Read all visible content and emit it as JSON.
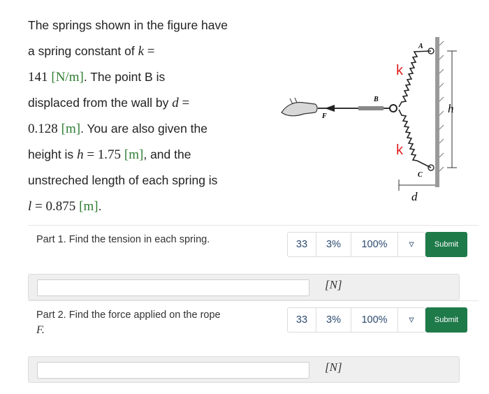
{
  "problem": {
    "t1": "The springs shown in the figure have",
    "t2": "a spring constant of",
    "k_sym": "k",
    "eq": "=",
    "k_val": "141",
    "k_unit": "[N/m]",
    "t3": ". The point B is",
    "t4": "displaced from the wall by",
    "d_sym": "d",
    "d_val": "0.128",
    "d_unit": "[m]",
    "t5": ". You are also given the",
    "t6": "height is",
    "h_sym": "h",
    "h_val": "1.75",
    "h_unit": "[m]",
    "t7": ", and the",
    "t8": "unstreched length of each spring is",
    "l_sym": "l",
    "l_val": "0.875",
    "l_unit": "[m]",
    "end": "."
  },
  "figure": {
    "label_A": "A",
    "label_B": "B",
    "label_C": "C",
    "label_F": "F",
    "label_k_top": "k",
    "label_k_bottom": "k",
    "label_h": "h",
    "label_d": "d",
    "k_color": "#e02020"
  },
  "parts": [
    {
      "label": "Part 1. Find the tension in each spring.",
      "label_sym": "",
      "attempts": "33",
      "percent": "3%",
      "score": "100%",
      "dropdown": "▿",
      "submit": "Submit",
      "unit": "[N]"
    },
    {
      "label": "Part 2. Find the force applied on the rope",
      "label_sym": "F.",
      "attempts": "33",
      "percent": "3%",
      "score": "100%",
      "dropdown": "▿",
      "submit": "Submit",
      "unit": "[N]"
    }
  ],
  "colors": {
    "submit": "#1f7a4a",
    "unit_green": "#2e7d32"
  }
}
